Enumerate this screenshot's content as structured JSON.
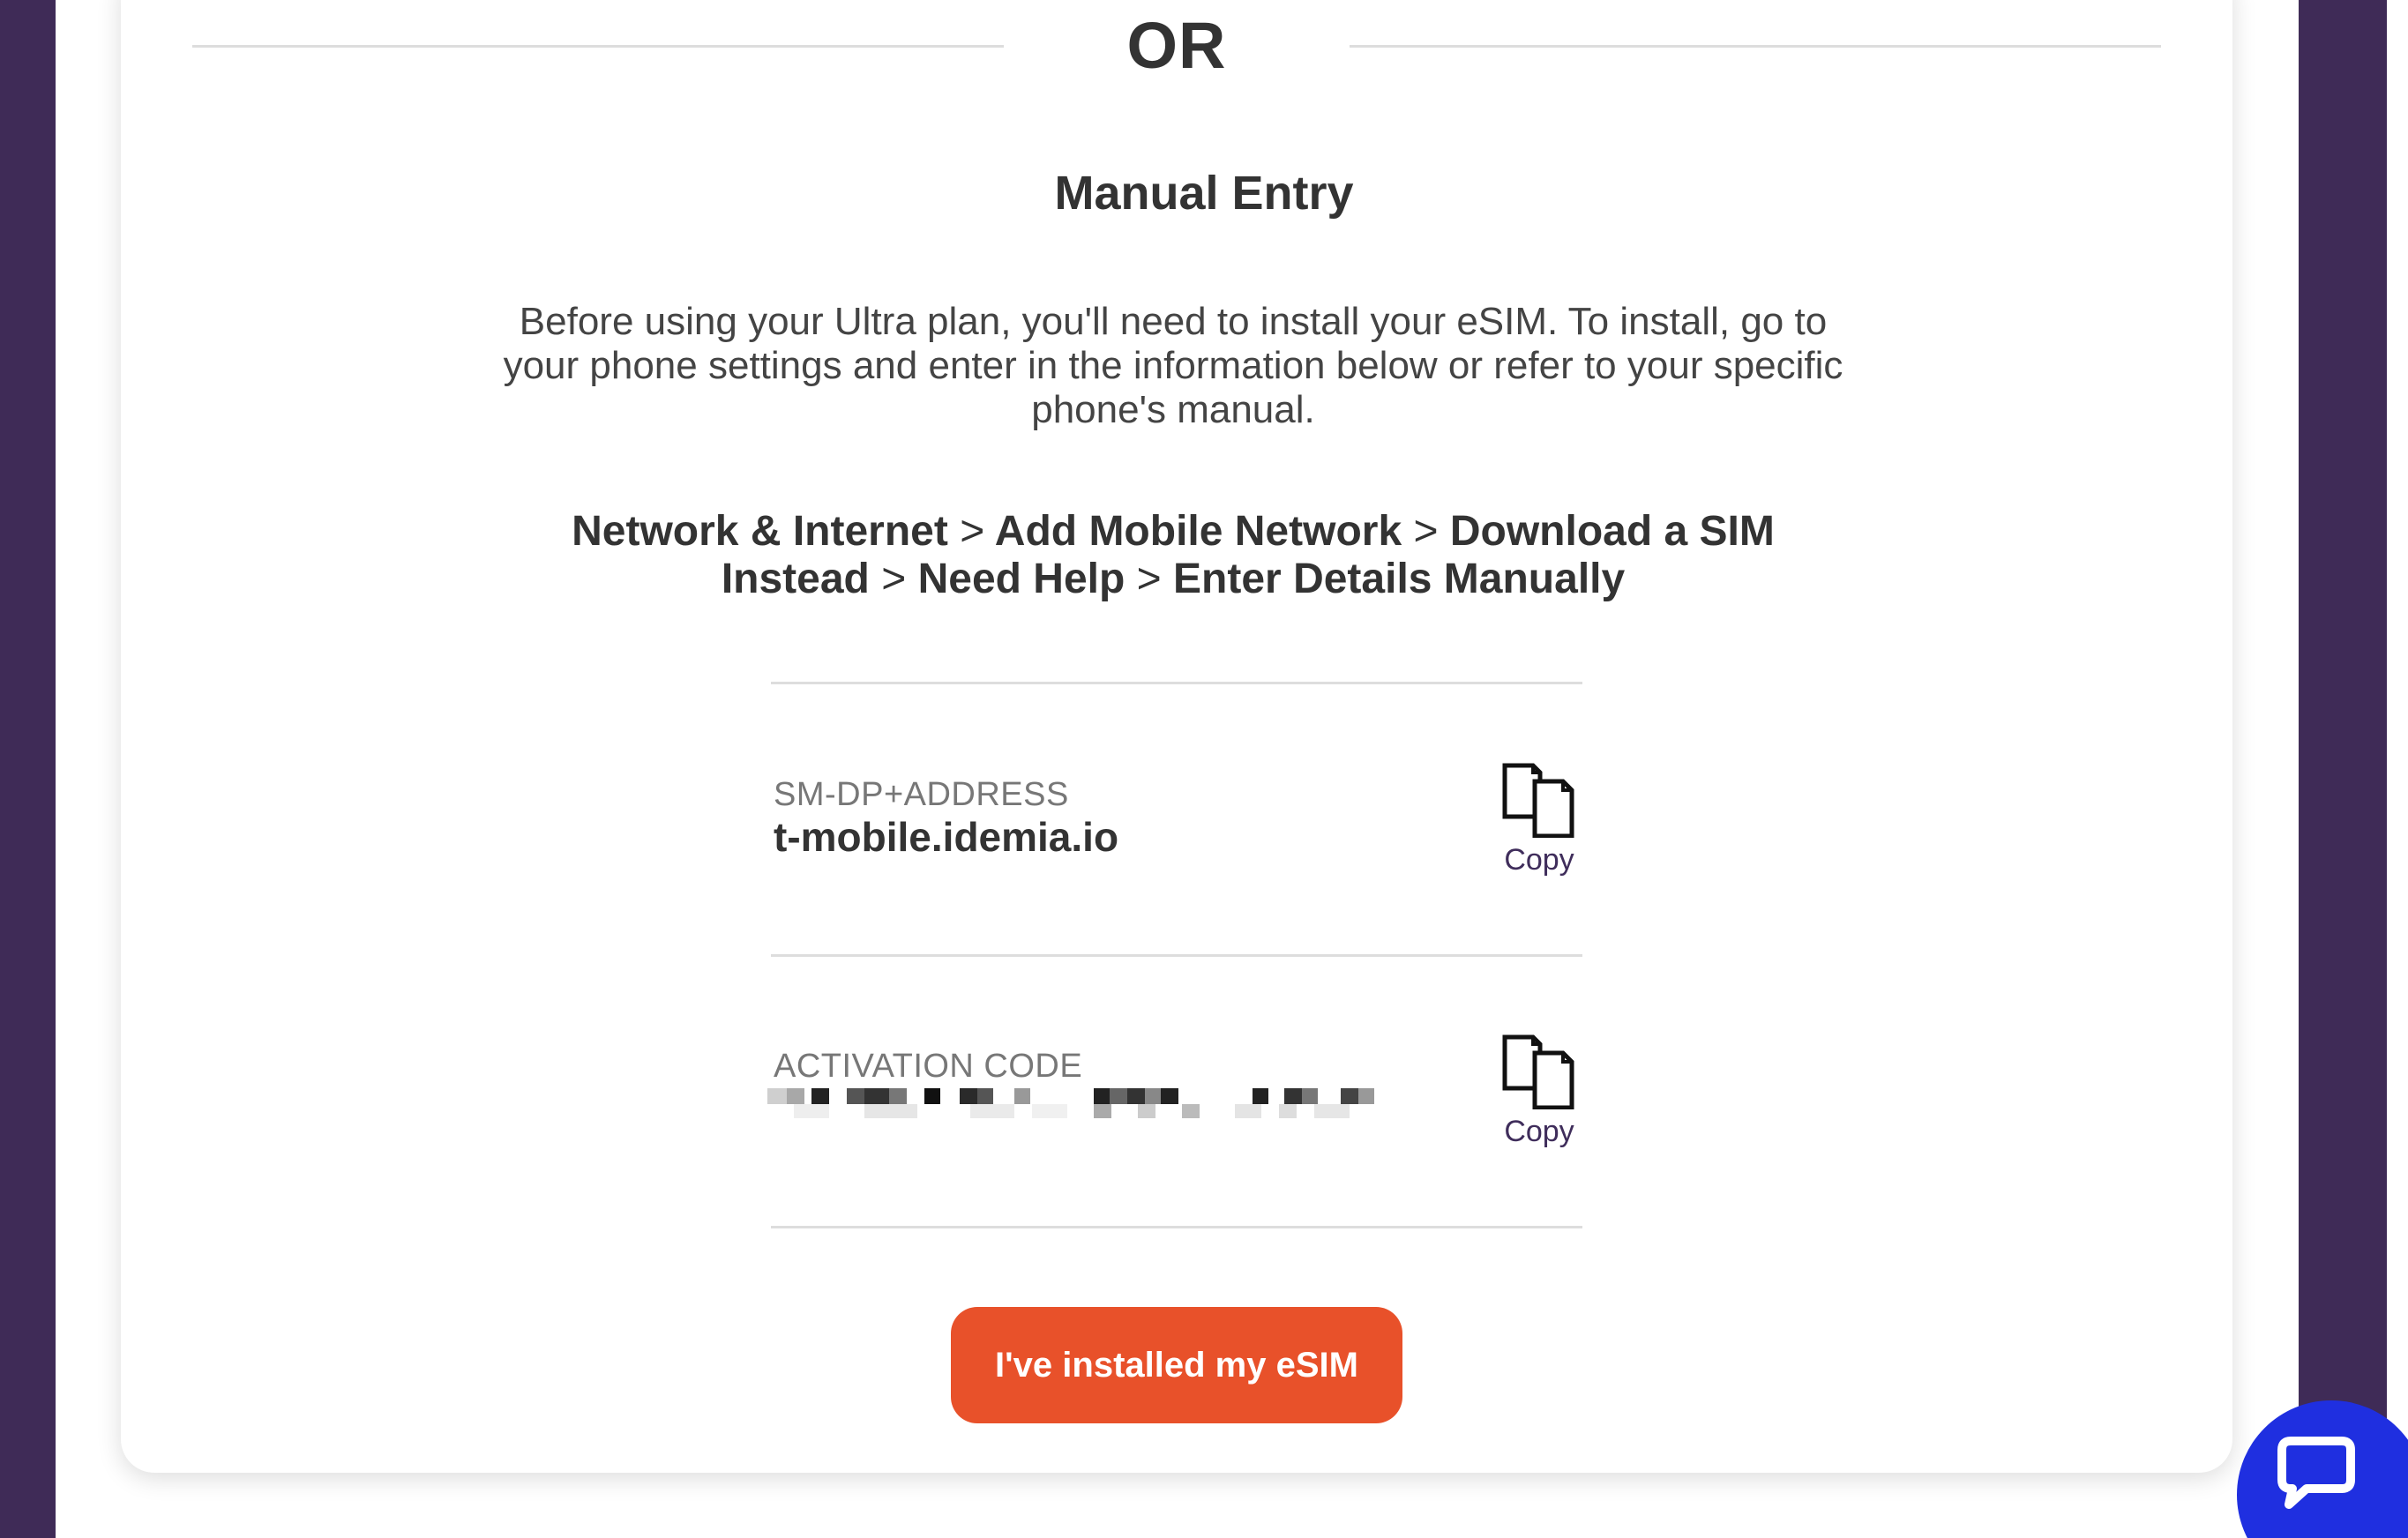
{
  "colors": {
    "frame": "#3f2b57",
    "accent_orange": "#e8512a",
    "chat_blue": "#1f2fe0",
    "copy_text": "#3f2d5b"
  },
  "divider_text": "OR",
  "manual_entry": {
    "title": "Manual Entry",
    "description": "Before using your Ultra plan, you'll need to install your eSIM. To install, go to your phone settings and enter in the information below or refer to your specific phone's manual.",
    "path": {
      "step1": "Network & Internet",
      "step2": "Add Mobile Network",
      "step3": "Download a SIM Instead",
      "step4": "Need Help",
      "step5": "Enter Details Manually",
      "separator": ">"
    }
  },
  "fields": {
    "smdp": {
      "label": "SM-DP+ADDRESS",
      "value": "t-mobile.idemia.io",
      "copy_label": "Copy",
      "icon": "copy-icon"
    },
    "activation": {
      "label": "ACTIVATION CODE",
      "copy_label": "Copy",
      "icon": "copy-icon"
    }
  },
  "install_button": {
    "label": "I've installed my eSIM"
  },
  "chat": {
    "icon": "chat-bubble-icon"
  }
}
